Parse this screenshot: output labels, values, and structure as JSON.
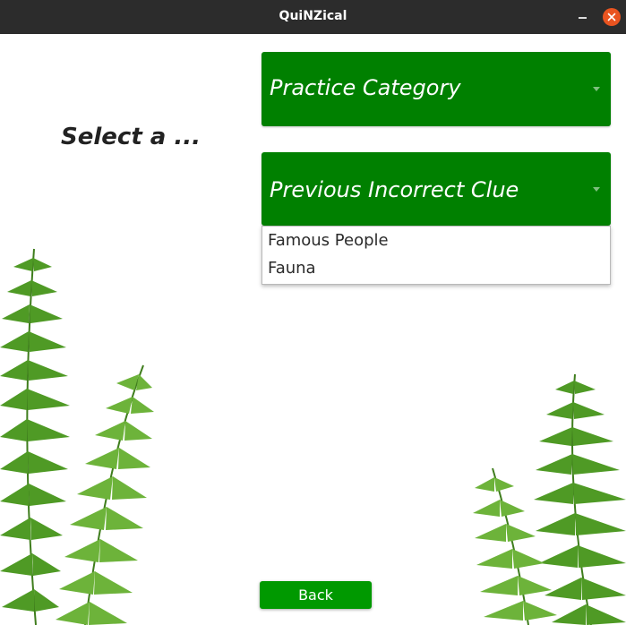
{
  "window": {
    "title": "QuiNZical",
    "minimize_icon": "minimize-icon",
    "close_icon": "close-icon",
    "close_color": "#e95420"
  },
  "page": {
    "heading": "Select a ..."
  },
  "combos": [
    {
      "selected": "Practice Category",
      "arrow_icon": "chevron-down-icon"
    },
    {
      "selected": "Previous Incorrect Clue",
      "arrow_icon": "chevron-down-icon"
    }
  ],
  "dropdown": {
    "options": [
      "Famous People",
      "Fauna"
    ]
  },
  "back_button": {
    "label": "Back"
  },
  "decoration": {
    "left_image": "fern-icon",
    "right_image": "fern-icon",
    "accent": "#008000",
    "button_color": "#009900"
  }
}
